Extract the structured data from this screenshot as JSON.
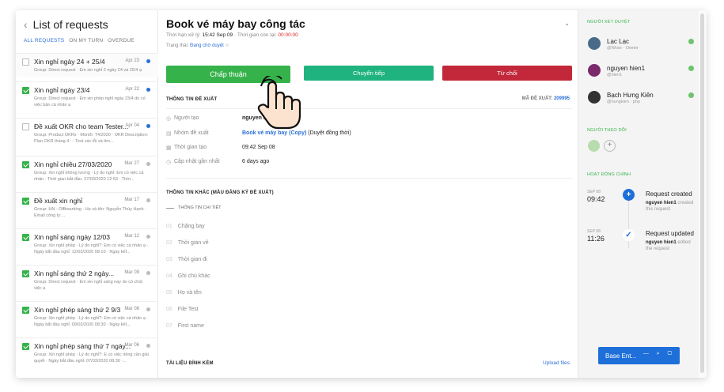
{
  "list": {
    "title": "List of requests",
    "tabs": [
      "ALL REQUESTS",
      "ON MY TURN",
      "OVERDUE"
    ],
    "items": [
      {
        "title": "Xin nghỉ ngày 24 + 25/4",
        "date": "Apr 23",
        "desc": "Group: Direct request · Em xin nghỉ 2 ngày 24 và 25/4 ạ",
        "checked": false,
        "dot": "blue"
      },
      {
        "title": "Xin nghỉ ngày 23/4",
        "date": "Apr 22",
        "desc": "Group: Direct request · Em xin phép nghỉ ngày 23/4 do có việc bận cá nhân ạ",
        "checked": true,
        "dot": "blue"
      },
      {
        "title": "Đề xuất OKR cho team Tester...",
        "date": "Apr 04",
        "desc": "Group: Product OKRs · Month: T4/2020 · OKR Description: Plan OKR tháng 4 : - Test các lỗi và tìm...",
        "checked": false,
        "dot": "blue"
      },
      {
        "title": "Xin nghỉ chiều 27/03/2020",
        "date": "Mar 27",
        "desc": "Group: Xin nghỉ không lương · Lý do nghỉ: Em có việc cá nhân · Thời gian bắt đầu: 27/03/2020 12:53 · Thời...",
        "checked": true,
        "dot": "grey"
      },
      {
        "title": "Đề xuất xin nghỉ",
        "date": "Mar 17",
        "desc": "Group: HN - Offboarding · Họ và tên: Nguyễn Thúy Hạnh · Email công ty:...",
        "checked": true,
        "dot": "grey"
      },
      {
        "title": "Xin nghỉ sáng ngày 12/03",
        "date": "Mar 12",
        "desc": "Group: Xin nghỉ phép · Lý do nghỉ?: Em có việc cá nhân ạ · Ngày bắt đầu nghỉ: 12/03/2020 08:10 · Ngày kết...",
        "checked": true,
        "dot": "grey"
      },
      {
        "title": "Xin nghỉ sáng thứ 2 ngày...",
        "date": "Mar 09",
        "desc": "Group: Direct request · Em xin nghỉ sáng nay do có chút việc ạ",
        "checked": true,
        "dot": "grey"
      },
      {
        "title": "Xin nghỉ phép sáng thứ 2 9/3",
        "date": "Mar 08",
        "desc": "Group: Xin nghỉ phép · Lý do nghỉ?: Em có việc cá nhân ạ · Ngày bắt đầu nghỉ: 09/03/2020 08:30 · Ngày kết...",
        "checked": true,
        "dot": "grey"
      },
      {
        "title": "Xin nghỉ phép sáng thứ 7 ngày...",
        "date": "Mar 06",
        "desc": "Group: Xin nghỉ phép · Lý do nghỉ?: E có việc riêng cần giải quyết · Ngày bắt đầu nghỉ: 07/03/2020 08:30 ·...",
        "checked": true,
        "dot": "grey"
      }
    ]
  },
  "detail": {
    "title": "Book vé máy bay công tác",
    "deadline_label": "Thời hạn xử lý: ",
    "deadline_value": "15:42 Sep 09",
    "remaining_label": " · Thời gian còn lại: ",
    "remaining_value": "00:00:00",
    "status_label": "Trạng thái: ",
    "status_value": "Đang chờ duyệt",
    "star": "☆",
    "approve": "Chấp thuận",
    "forward": "Chuyển tiếp",
    "reject": "Từ chối",
    "proposal_header": "THÔNG TIN ĐỀ XUẤT",
    "code_label": "MÃ ĐỀ XUẤT: ",
    "code_value": "209995",
    "creator_label": "Người tạo",
    "creator_value": "nguyen hie",
    "group_label": "Nhóm đề xuất",
    "group_link": "Book vé máy bay (Copy)",
    "group_extra": " (Duyệt đồng thời)",
    "created_label": "Thời gian tạo",
    "created_value": "09:42 Sep 08",
    "updated_label": "Cập nhật gần nhất",
    "updated_value": "6 days ago",
    "other_header": "THÔNG TIN KHÁC (MẪU ĐĂNG KÝ ĐỀ XUẤT)",
    "sub_header": "THÔNG TIN CHI TIẾT",
    "fields": [
      {
        "n": "01",
        "label": "Chặng bay"
      },
      {
        "n": "02",
        "label": "Thời gian về"
      },
      {
        "n": "03",
        "label": "Thời gian đi"
      },
      {
        "n": "04",
        "label": "Ghi chú khác"
      },
      {
        "n": "05",
        "label": "Họ và tên"
      },
      {
        "n": "06",
        "label": "File Test"
      },
      {
        "n": "07",
        "label": "First name"
      }
    ],
    "attach_header": "TÀI LIỆU ĐÍNH KÈM",
    "upload": "Upload files"
  },
  "side": {
    "approvers_header": "NGƯỜI XÉT DUYỆT",
    "approvers": [
      {
        "name": "Lạc Lạc",
        "sub": "@Nhan · Owner"
      },
      {
        "name": "nguyen hien1",
        "sub": "@hien1"
      },
      {
        "name": "Bạch Hưng Kiên",
        "sub": "@hungkien · php"
      }
    ],
    "followers_header": "NGƯỜI THEO DÕI",
    "add": "+",
    "activity_header": "HOẠT ĐỘNG CHÍNH",
    "activities": [
      {
        "date": "SEP 08",
        "time": "09:42",
        "title": "Request created",
        "who": "nguyen hien1",
        "action": " created this request"
      },
      {
        "date": "SEP 08",
        "time": "11:26",
        "title": "Request updated",
        "who": "nguyen hien1",
        "action": " edited the request"
      }
    ]
  },
  "chat": {
    "label": "Base Ent..."
  },
  "colors": {
    "accent": "#2b6fd6",
    "approve": "#35b34a",
    "forward": "#1fb37f",
    "reject": "#c2283a"
  }
}
